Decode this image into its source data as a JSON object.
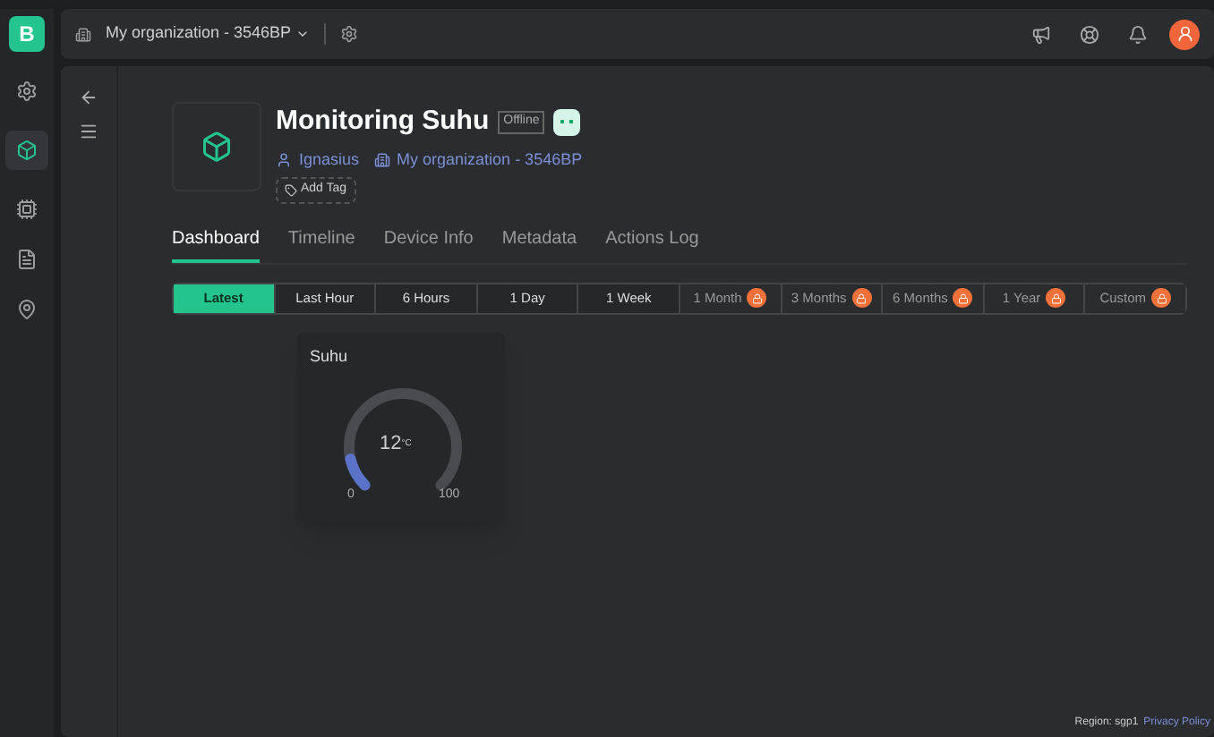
{
  "app": {
    "logo": "B"
  },
  "topbar": {
    "organization": "My organization - 3546BP"
  },
  "device": {
    "name": "Monitoring Suhu",
    "status": "Offline",
    "owner": "Ignasius",
    "organization": "My organization - 3546BP",
    "add_tag": "Add Tag"
  },
  "tabs": [
    {
      "label": "Dashboard",
      "selected": true
    },
    {
      "label": "Timeline",
      "selected": false
    },
    {
      "label": "Device Info",
      "selected": false
    },
    {
      "label": "Metadata",
      "selected": false
    },
    {
      "label": "Actions Log",
      "selected": false
    }
  ],
  "ranges": [
    {
      "label": "Latest",
      "selected": true,
      "locked": false
    },
    {
      "label": "Last Hour",
      "selected": false,
      "locked": false
    },
    {
      "label": "6 Hours",
      "selected": false,
      "locked": false
    },
    {
      "label": "1 Day",
      "selected": false,
      "locked": false
    },
    {
      "label": "1 Week",
      "selected": false,
      "locked": false
    },
    {
      "label": "1 Month",
      "selected": false,
      "locked": true
    },
    {
      "label": "3 Months",
      "selected": false,
      "locked": true
    },
    {
      "label": "6 Months",
      "selected": false,
      "locked": true
    },
    {
      "label": "1 Year",
      "selected": false,
      "locked": true
    },
    {
      "label": "Custom",
      "selected": false,
      "locked": true
    }
  ],
  "widget": {
    "title": "Suhu",
    "value": "12",
    "unit": "°C",
    "level": 0.12,
    "min": "0",
    "max": "100"
  },
  "footer": {
    "region": "Region: sgp1",
    "privacy": "Privacy Policy"
  }
}
